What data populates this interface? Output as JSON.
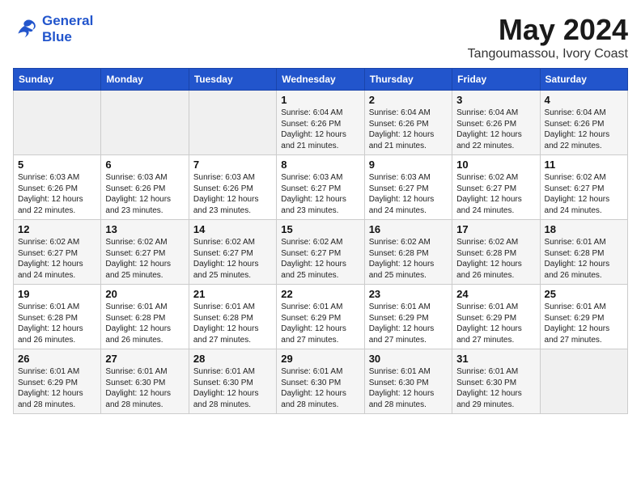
{
  "logo": {
    "line1": "General",
    "line2": "Blue"
  },
  "title": {
    "month_year": "May 2024",
    "location": "Tangoumassou, Ivory Coast"
  },
  "headers": [
    "Sunday",
    "Monday",
    "Tuesday",
    "Wednesday",
    "Thursday",
    "Friday",
    "Saturday"
  ],
  "weeks": [
    [
      {
        "day": "",
        "info": ""
      },
      {
        "day": "",
        "info": ""
      },
      {
        "day": "",
        "info": ""
      },
      {
        "day": "1",
        "info": "Sunrise: 6:04 AM\nSunset: 6:26 PM\nDaylight: 12 hours\nand 21 minutes."
      },
      {
        "day": "2",
        "info": "Sunrise: 6:04 AM\nSunset: 6:26 PM\nDaylight: 12 hours\nand 21 minutes."
      },
      {
        "day": "3",
        "info": "Sunrise: 6:04 AM\nSunset: 6:26 PM\nDaylight: 12 hours\nand 22 minutes."
      },
      {
        "day": "4",
        "info": "Sunrise: 6:04 AM\nSunset: 6:26 PM\nDaylight: 12 hours\nand 22 minutes."
      }
    ],
    [
      {
        "day": "5",
        "info": "Sunrise: 6:03 AM\nSunset: 6:26 PM\nDaylight: 12 hours\nand 22 minutes."
      },
      {
        "day": "6",
        "info": "Sunrise: 6:03 AM\nSunset: 6:26 PM\nDaylight: 12 hours\nand 23 minutes."
      },
      {
        "day": "7",
        "info": "Sunrise: 6:03 AM\nSunset: 6:26 PM\nDaylight: 12 hours\nand 23 minutes."
      },
      {
        "day": "8",
        "info": "Sunrise: 6:03 AM\nSunset: 6:27 PM\nDaylight: 12 hours\nand 23 minutes."
      },
      {
        "day": "9",
        "info": "Sunrise: 6:03 AM\nSunset: 6:27 PM\nDaylight: 12 hours\nand 24 minutes."
      },
      {
        "day": "10",
        "info": "Sunrise: 6:02 AM\nSunset: 6:27 PM\nDaylight: 12 hours\nand 24 minutes."
      },
      {
        "day": "11",
        "info": "Sunrise: 6:02 AM\nSunset: 6:27 PM\nDaylight: 12 hours\nand 24 minutes."
      }
    ],
    [
      {
        "day": "12",
        "info": "Sunrise: 6:02 AM\nSunset: 6:27 PM\nDaylight: 12 hours\nand 24 minutes."
      },
      {
        "day": "13",
        "info": "Sunrise: 6:02 AM\nSunset: 6:27 PM\nDaylight: 12 hours\nand 25 minutes."
      },
      {
        "day": "14",
        "info": "Sunrise: 6:02 AM\nSunset: 6:27 PM\nDaylight: 12 hours\nand 25 minutes."
      },
      {
        "day": "15",
        "info": "Sunrise: 6:02 AM\nSunset: 6:27 PM\nDaylight: 12 hours\nand 25 minutes."
      },
      {
        "day": "16",
        "info": "Sunrise: 6:02 AM\nSunset: 6:28 PM\nDaylight: 12 hours\nand 25 minutes."
      },
      {
        "day": "17",
        "info": "Sunrise: 6:02 AM\nSunset: 6:28 PM\nDaylight: 12 hours\nand 26 minutes."
      },
      {
        "day": "18",
        "info": "Sunrise: 6:01 AM\nSunset: 6:28 PM\nDaylight: 12 hours\nand 26 minutes."
      }
    ],
    [
      {
        "day": "19",
        "info": "Sunrise: 6:01 AM\nSunset: 6:28 PM\nDaylight: 12 hours\nand 26 minutes."
      },
      {
        "day": "20",
        "info": "Sunrise: 6:01 AM\nSunset: 6:28 PM\nDaylight: 12 hours\nand 26 minutes."
      },
      {
        "day": "21",
        "info": "Sunrise: 6:01 AM\nSunset: 6:28 PM\nDaylight: 12 hours\nand 27 minutes."
      },
      {
        "day": "22",
        "info": "Sunrise: 6:01 AM\nSunset: 6:29 PM\nDaylight: 12 hours\nand 27 minutes."
      },
      {
        "day": "23",
        "info": "Sunrise: 6:01 AM\nSunset: 6:29 PM\nDaylight: 12 hours\nand 27 minutes."
      },
      {
        "day": "24",
        "info": "Sunrise: 6:01 AM\nSunset: 6:29 PM\nDaylight: 12 hours\nand 27 minutes."
      },
      {
        "day": "25",
        "info": "Sunrise: 6:01 AM\nSunset: 6:29 PM\nDaylight: 12 hours\nand 27 minutes."
      }
    ],
    [
      {
        "day": "26",
        "info": "Sunrise: 6:01 AM\nSunset: 6:29 PM\nDaylight: 12 hours\nand 28 minutes."
      },
      {
        "day": "27",
        "info": "Sunrise: 6:01 AM\nSunset: 6:30 PM\nDaylight: 12 hours\nand 28 minutes."
      },
      {
        "day": "28",
        "info": "Sunrise: 6:01 AM\nSunset: 6:30 PM\nDaylight: 12 hours\nand 28 minutes."
      },
      {
        "day": "29",
        "info": "Sunrise: 6:01 AM\nSunset: 6:30 PM\nDaylight: 12 hours\nand 28 minutes."
      },
      {
        "day": "30",
        "info": "Sunrise: 6:01 AM\nSunset: 6:30 PM\nDaylight: 12 hours\nand 28 minutes."
      },
      {
        "day": "31",
        "info": "Sunrise: 6:01 AM\nSunset: 6:30 PM\nDaylight: 12 hours\nand 29 minutes."
      },
      {
        "day": "",
        "info": ""
      }
    ]
  ]
}
